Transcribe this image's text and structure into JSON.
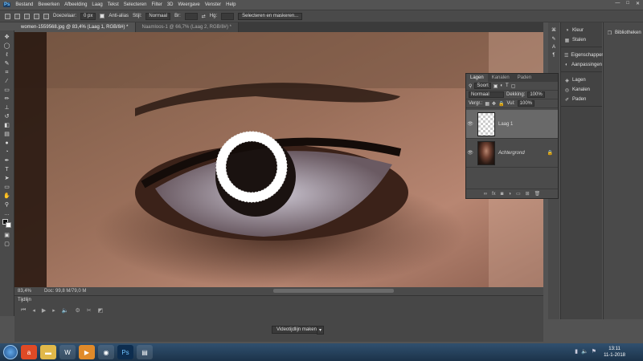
{
  "app": {
    "logo": "Ps"
  },
  "menu": [
    "Bestand",
    "Bewerken",
    "Afbeelding",
    "Laag",
    "Tekst",
    "Selecteren",
    "Filter",
    "3D",
    "Weergave",
    "Venster",
    "Help"
  ],
  "window_controls": [
    "—",
    "□",
    "✕"
  ],
  "options": {
    "feather_label": "Doezelaar:",
    "feather_value": "0 px",
    "antialias_label": "Anti-alias",
    "style_label": "Stijl:",
    "style_value": "Normaal",
    "width_label": "Br:",
    "height_label": "Hg:",
    "select_mask_button": "Selecteren en maskeren..."
  },
  "tabs": [
    {
      "label": "women-1559568.jpg @ 83,4% (Laag 1, RGB/8#) *",
      "active": true
    },
    {
      "label": "Naamloos-1 @ 66,7% (Laag 2, RGB/8#) *",
      "active": false
    }
  ],
  "status": {
    "zoom": "83,4%",
    "doc": "Doc: 99,8 M/79,0 M"
  },
  "timeline": {
    "title": "Tijdlijn",
    "create_button": "Videotijdlijn maken"
  },
  "right_panel": {
    "groups": [
      [
        {
          "label": "Kleur",
          "icon": "color-icon"
        },
        {
          "label": "Stalen",
          "icon": "swatches-icon"
        }
      ],
      [
        {
          "label": "Eigenschappen",
          "icon": "properties-icon"
        },
        {
          "label": "Aanpassingen",
          "icon": "adjustments-icon"
        }
      ],
      [
        {
          "label": "Lagen",
          "icon": "layers-icon"
        },
        {
          "label": "Kanalen",
          "icon": "channels-icon"
        },
        {
          "label": "Paden",
          "icon": "paths-icon"
        }
      ]
    ],
    "library": "Bibliotheken"
  },
  "layers_panel": {
    "tabs": [
      "Lagen",
      "Kanalen",
      "Paden"
    ],
    "kind_filter": "Soort",
    "blend_mode": "Normaal",
    "opacity_label": "Dekking:",
    "opacity_value": "100%",
    "lock_label": "Vergr.:",
    "fill_label": "Vul:",
    "fill_value": "100%",
    "layers": [
      {
        "name": "Laag 1",
        "selected": true
      },
      {
        "name": "Achtergrond",
        "selected": false
      }
    ]
  },
  "taskbar": {
    "apps": [
      "action-icon",
      "explorer-icon",
      "word-icon",
      "media-icon",
      "chrome-icon",
      "photoshop-icon",
      "files-icon"
    ],
    "clock_time": "13:11",
    "clock_date": "11-1-2018"
  }
}
